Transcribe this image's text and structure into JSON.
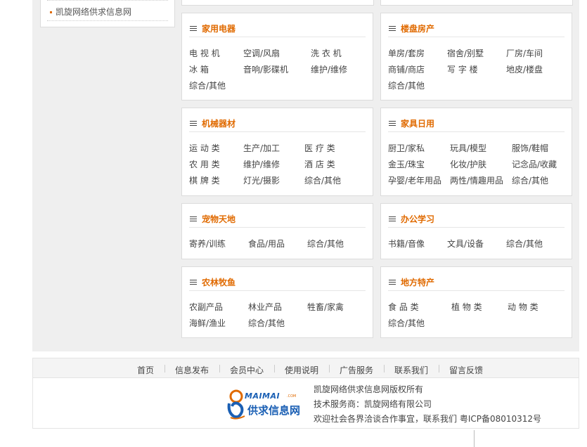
{
  "sidebar": {
    "link": "凯旋网络供求信息网"
  },
  "panels": [
    {
      "title": "家用电器",
      "items": [
        "电 视 机",
        "空调/风扇",
        "洗 衣 机",
        "冰 箱",
        "音响/影碟机",
        "维护/维修",
        "综合/其他"
      ]
    },
    {
      "title": "楼盘房产",
      "items": [
        "单房/套房",
        "宿舍/别墅",
        "厂房/车间",
        "商铺/商店",
        "写 字 楼",
        "地皮/楼盘",
        "综合/其他"
      ]
    },
    {
      "title": "机械器材",
      "items": [
        "运 动 类",
        "生产/加工",
        "医 疗 类",
        "农 用 类",
        "维护/维修",
        "酒 店 类",
        "棋 牌 类",
        "灯光/摄影",
        "综合/其他"
      ]
    },
    {
      "title": "家具日用",
      "items": [
        "厨卫/家私",
        "玩具/模型",
        "服饰/鞋帽",
        "金玉/珠宝",
        "化妆/护肤",
        "记念品/收藏",
        "孕婴/老年用品",
        "两性/情趣用品",
        "综合/其他"
      ]
    },
    {
      "title": "宠物天地",
      "items": [
        "寄养/训练",
        "食品/用品",
        "综合/其他"
      ]
    },
    {
      "title": "办公学习",
      "items": [
        "书籍/音像",
        "文具/设备",
        "综合/其他"
      ]
    },
    {
      "title": "农林牧鱼",
      "items": [
        "农副产品",
        "林业产品",
        "牲畜/家禽",
        "海鲜/渔业",
        "综合/其他"
      ]
    },
    {
      "title": "地方特产",
      "items": [
        "食 品 类",
        "植 物 类",
        "动 物 类",
        "综合/其他"
      ]
    }
  ],
  "footer": {
    "nav": [
      "首页",
      "信息发布",
      "会员中心",
      "使用说明",
      "广告服务",
      "联系我们",
      "留言反馈"
    ],
    "logo": {
      "brand": "MAIMAI",
      "suffix": ".COM",
      "name": "供求信息网"
    },
    "lines": [
      "凯旋网络供求信息网版权所有",
      "技术服务商：凯旋网络有限公司",
      "欢迎社会各界洽谈合作事宜，联系我们  粤ICP备08010312号"
    ]
  },
  "colors": {
    "accent": "#e06a00",
    "logo_blue": "#1a5fb4",
    "background": "#efefef"
  }
}
